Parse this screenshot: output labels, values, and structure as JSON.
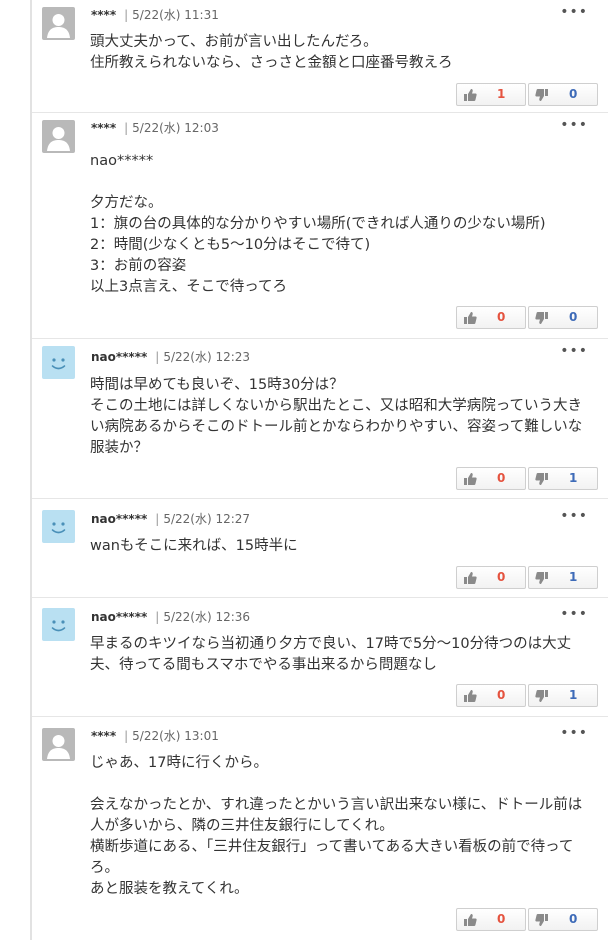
{
  "comments": [
    {
      "author": "****",
      "sep": "|",
      "time": "5/22(水) 11:31",
      "avatar": "default-gray",
      "body": "頭大丈夫かって、お前が言い出したんだろ。\n住所教えられないなら、さっさと金額と口座番号教えろ",
      "up": "1",
      "down": "0"
    },
    {
      "author": "****",
      "sep": "|",
      "time": "5/22(水) 12:03",
      "avatar": "default-gray",
      "body": "nao*****\n\n夕方だな。\n1：旗の台の具体的な分かりやすい場所(できれば人通りの少ない場所)\n2：時間(少なくとも5～10分はそこで待て)\n3：お前の容姿\n以上3点言え、そこで待ってろ",
      "up": "0",
      "down": "0"
    },
    {
      "author": "nao*****",
      "sep": "|",
      "time": "5/22(水) 12:23",
      "avatar": "smile-blue",
      "body": "時間は早めても良いぞ、15時30分は？\nそこの土地には詳しくないから駅出たとこ、又は昭和大学病院っていう大きい病院あるからそこのドトール前とかならわかりやすい、容姿って難しいな服装か？",
      "up": "0",
      "down": "1"
    },
    {
      "author": "nao*****",
      "sep": "|",
      "time": "5/22(水) 12:27",
      "avatar": "smile-blue",
      "body": "wanもそこに来れば、15時半に",
      "up": "0",
      "down": "1"
    },
    {
      "author": "nao*****",
      "sep": "|",
      "time": "5/22(水) 12:36",
      "avatar": "smile-blue",
      "body": "早まるのキツイなら当初通り夕方で良い、17時で5分～10分待つのは大丈夫、待ってる間もスマホでやる事出来るから問題なし",
      "up": "0",
      "down": "1"
    },
    {
      "author": "****",
      "sep": "|",
      "time": "5/22(水) 13:01",
      "avatar": "default-gray",
      "body": "じゃあ、17時に行くから。\n\n会えなかったとか、すれ違ったとかいう言い訳出来ない様に、ドトール前は人が多いから、隣の三井住友銀行にしてくれ。\n横断歩道にある、「三井住友銀行」って書いてある大きい看板の前で待ってろ。\nあと服装を教えてくれ。",
      "up": "0",
      "down": "0"
    }
  ],
  "ui": {
    "more_icon": "more-horizontal-icon",
    "more_glyph": "•••",
    "thumb_up_icon": "thumbs-up-icon",
    "thumb_down_icon": "thumbs-down-icon",
    "colors": {
      "up_count": "#e5533f",
      "down_count": "#3e6bb8",
      "avatar_gray": "#b9b9b9",
      "avatar_blue": "#b9e0f2"
    }
  }
}
